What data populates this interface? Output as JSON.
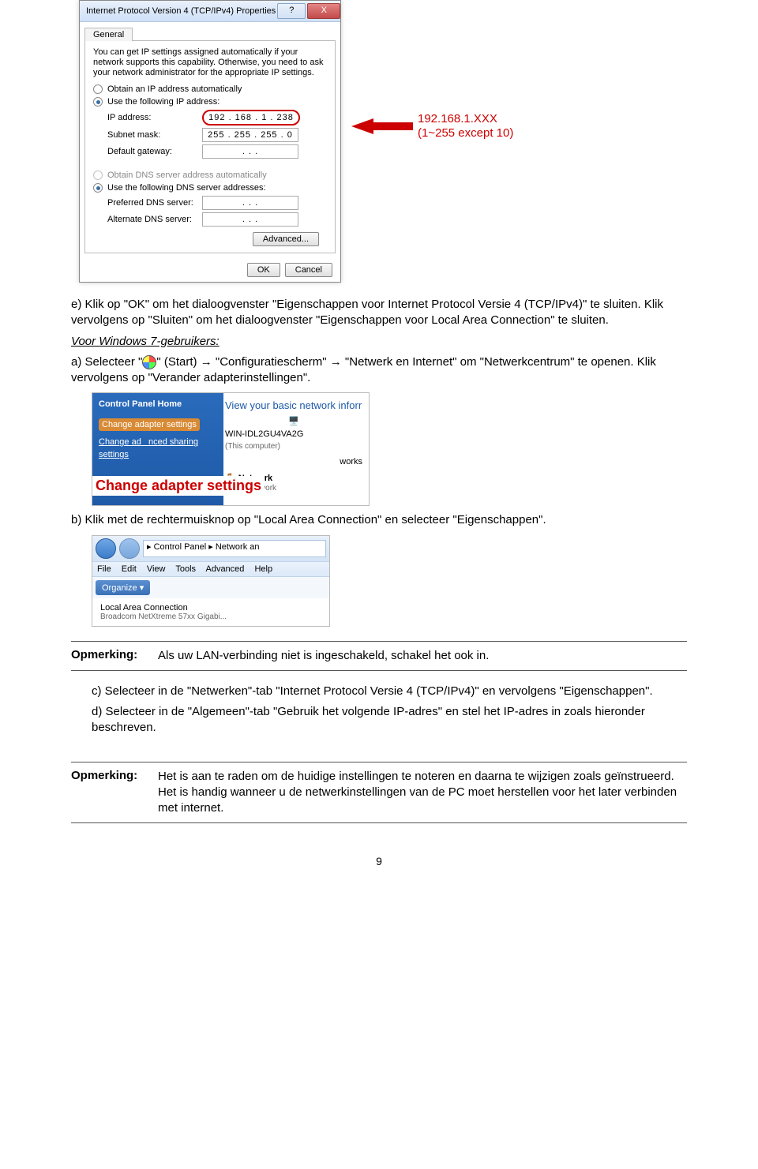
{
  "dialog": {
    "title": "Internet Protocol Version 4 (TCP/IPv4) Properties",
    "help": "?",
    "close": "X",
    "tab": "General",
    "desc": "You can get IP settings assigned automatically if your network supports this capability. Otherwise, you need to ask your network administrator for the appropriate IP settings.",
    "opt_auto_ip": "Obtain an IP address automatically",
    "opt_use_ip": "Use the following IP address:",
    "lbl_ip": "IP address:",
    "val_ip": "192 . 168 .   1 . 238",
    "lbl_mask": "Subnet mask:",
    "val_mask": "255 . 255 . 255 .   0",
    "lbl_gw": "Default gateway:",
    "val_gw": ".        .        .",
    "opt_auto_dns": "Obtain DNS server address automatically",
    "opt_use_dns": "Use the following DNS server addresses:",
    "lbl_pref": "Preferred DNS server:",
    "val_pref": ".        .        .",
    "lbl_alt": "Alternate DNS server:",
    "val_alt": ".        .        .",
    "advanced": "Advanced...",
    "ok": "OK",
    "cancel": "Cancel"
  },
  "annot": {
    "line1": "192.168.1.XXX",
    "line2": "(1~255 except 10)"
  },
  "body": {
    "e": "e)  Klik op \"OK\" om het dialoogvenster \"Eigenschappen voor Internet Protocol Versie 4 (TCP/IPv4)\" te sluiten. Klik vervolgens op \"Sluiten\" om het dialoogvenster \"Eigenschappen voor Local Area Connection\" te sluiten.",
    "win7": "Voor Windows 7-gebruikers:",
    "a_pre": "a)  Selecteer \"",
    "a_post": "\" (Start) → \"Configuratiescherm\" → \"Netwerk en Internet\" om \"Netwerkcentrum\" te openen. Klik vervolgens op \"Verander adapterinstellingen\".",
    "b": "b)  Klik met de rechtermuisknop op \"Local Area Connection\" en selecteer \"Eigenschappen\".",
    "c": "c)  Selecteer in de \"Netwerken\"-tab \"Internet Protocol Versie 4 (TCP/IPv4)\" en vervolgens \"Eigenschappen\".",
    "d": "d)  Selecteer in de \"Algemeen\"-tab \"Gebruik het volgende IP-adres\" en stel het IP-adres in zoals hieronder beschreven."
  },
  "shot2": {
    "home": "Control Panel Home",
    "link1": "Change adapter settings",
    "link2a": "Change ad",
    "link2b": "nced sharing",
    "link3": "settings",
    "title": "View your basic network inforr",
    "comp": "WIN-IDL2GU4VA2G",
    "compsub": "(This computer)",
    "works": "works",
    "net": "Network",
    "netsub": "Public network",
    "overlay": "Change adapter settings"
  },
  "shot3": {
    "path": "▸ Control Panel ▸ Network an",
    "menu": [
      "File",
      "Edit",
      "View",
      "Tools",
      "Advanced",
      "Help"
    ],
    "organize": "Organize ▾",
    "lac": "Local Area Connection",
    "dev": "Broadcom NetXtreme 57xx Gigabi..."
  },
  "notes": {
    "label": "Opmerking:",
    "n1": "Als uw LAN-verbinding niet is ingeschakeld, schakel het ook in.",
    "n2": "Het is aan te raden om de huidige instellingen te noteren en daarna te wijzigen zoals geïnstrueerd. Het is handig wanneer u de netwerkinstellingen van de PC moet herstellen voor het later verbinden met internet."
  },
  "pagenum": "9"
}
